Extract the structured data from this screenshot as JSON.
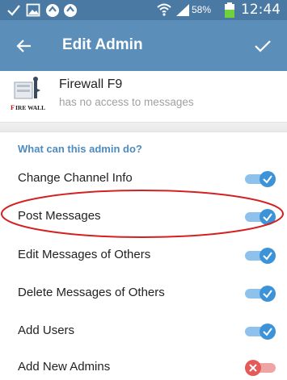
{
  "status_bar": {
    "battery_percent": "58%",
    "time": "12:44",
    "icons": [
      "check-icon",
      "image-icon",
      "sync-icon",
      "sync-icon",
      "wifi-icon",
      "signal-icon",
      "battery-icon"
    ]
  },
  "app_bar": {
    "title": "Edit Admin",
    "back_icon": "arrow-left-icon",
    "confirm_icon": "checkmark-icon",
    "background": "#5b8fb9"
  },
  "profile": {
    "name": "Firewall F9",
    "status": "has no access to messages",
    "avatar_text": "IRE WALL"
  },
  "section": {
    "header": "What can this admin do?"
  },
  "permissions": [
    {
      "label": "Change Channel Info",
      "enabled": true
    },
    {
      "label": "Post Messages",
      "enabled": true
    },
    {
      "label": "Edit Messages of Others",
      "enabled": true
    },
    {
      "label": "Delete Messages of Others",
      "enabled": true
    },
    {
      "label": "Add Users",
      "enabled": true
    },
    {
      "label": "Add New Admins",
      "enabled": false
    }
  ],
  "colors": {
    "accent": "#3c93d8",
    "toggle_off": "#e45a5a",
    "annotation": "#d42020"
  }
}
